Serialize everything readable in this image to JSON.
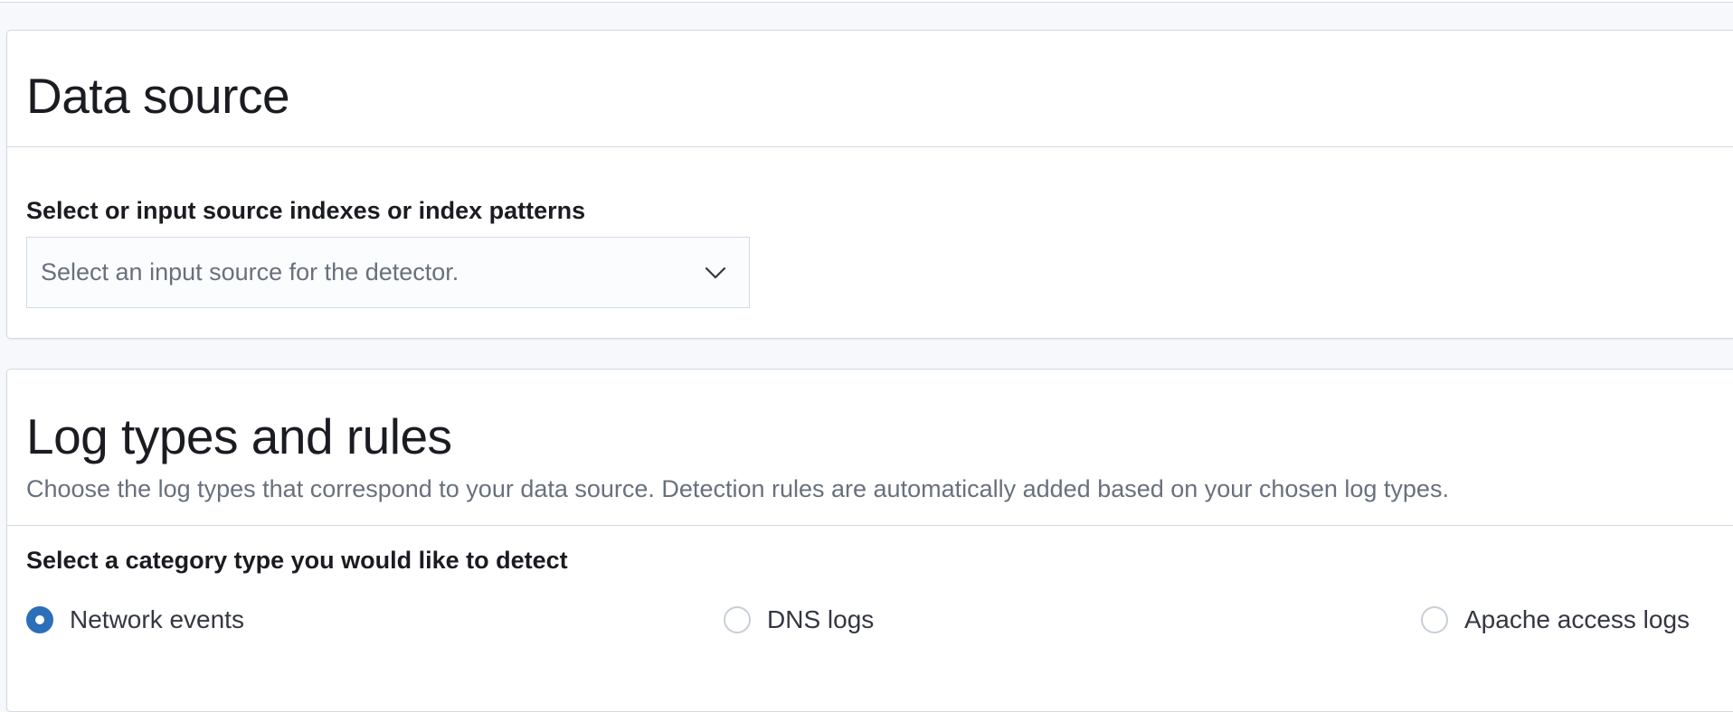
{
  "data_source": {
    "title": "Data source",
    "index_label": "Select or input source indexes or index patterns",
    "index_select": {
      "placeholder": "Select an input source for the detector.",
      "icon": "chevron-down-icon"
    }
  },
  "log_types": {
    "title": "Log types and rules",
    "description": "Choose the log types that correspond to your data source. Detection rules are automatically added based on your chosen log types.",
    "category_label": "Select a category type you would like to detect",
    "options": [
      {
        "label": "Network events",
        "checked": true
      },
      {
        "label": "DNS logs",
        "checked": false
      },
      {
        "label": "Apache access logs",
        "checked": false
      }
    ]
  },
  "colors": {
    "accent": "#2b70b8",
    "border": "#d3dae6",
    "page_background": "#f7f8fc",
    "muted_text": "#69707d"
  }
}
